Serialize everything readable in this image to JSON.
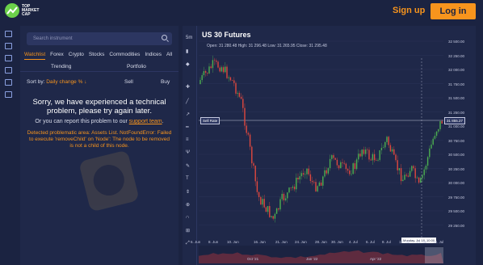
{
  "brand": {
    "line1": "TOP",
    "line2": "MARKET",
    "line3": "CAP"
  },
  "header": {
    "signup": "Sign up",
    "login": "Log in"
  },
  "panel": {
    "search_placeholder": "Search instrument",
    "tabs": [
      "Watchlist",
      "Forex",
      "Crypto",
      "Stocks",
      "Commodities",
      "Indices",
      "All"
    ],
    "subtabs": [
      "Trending",
      "Portfolio"
    ],
    "sort_label": "Sort by:",
    "sort_value": "Daily change %",
    "col_sell": "Sell",
    "col_buy": "Buy"
  },
  "error": {
    "title": "Sorry, we have experienced a technical problem, please try again later.",
    "sub_prefix": "Or you can report this problem to our",
    "sub_link": "support team",
    "detail": "Detected problematic area: Assets List. NotFoundError: Failed to execute 'removeChild' on 'Node': The node to be removed is not a child of this node."
  },
  "chart": {
    "symbol": "US 30 Futures",
    "ohlc": "Open: 31 280.48 High: 31 296.48 Low: 31 265.95 Close: 31 295.48",
    "sell_rate_label": "Sell Rate",
    "price_tag": "31 855.27",
    "date_tag": "Monday, Jul 18, 10:00",
    "toolbar_first": "5m",
    "y_ticks": [
      "32 500.00",
      "32 250.00",
      "32 000.00",
      "31 750.00",
      "31 500.00",
      "31 250.00",
      "31 000.00",
      "30 750.00",
      "30 500.00",
      "30 250.00",
      "30 000.00",
      "29 750.00",
      "29 500.00",
      "29 250.00"
    ],
    "x_ticks": [
      "6. Jun",
      "8. Jun",
      "10. Jun",
      "16. Jun",
      "21. Jun",
      "24. Jun",
      "28. Jun",
      "30. Jun",
      "4. Jul",
      "6. Jul",
      "8. Jul",
      "12. Jul",
      "14. Jul",
      "18. Jul"
    ],
    "nav_ticks": [
      "Oct '21",
      "Jan '22",
      "Apr '22"
    ]
  },
  "colors": {
    "up": "#4caf50",
    "down": "#e0483e",
    "accent": "#f7941d"
  }
}
